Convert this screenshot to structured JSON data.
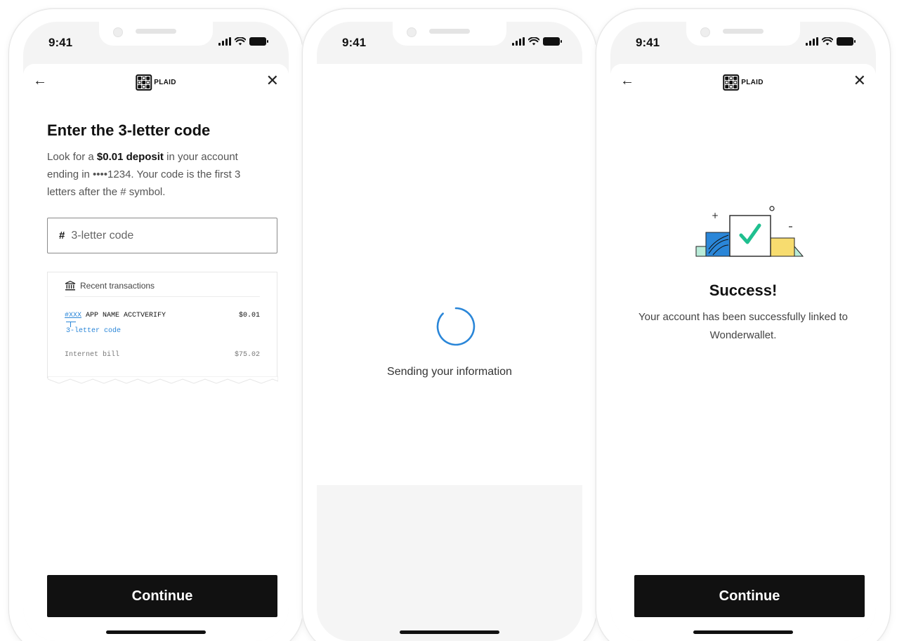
{
  "status_bar": {
    "time": "9:41"
  },
  "brand": {
    "name": "PLAID"
  },
  "screen1": {
    "title": "Enter the 3-letter code",
    "description_pre": "Look for a ",
    "description_bold": "$0.01 deposit",
    "description_post": " in your account ending in ••••1234. Your code is the first 3 letters after the # symbol.",
    "input": {
      "prefix": "#",
      "placeholder": "3-letter code",
      "value": ""
    },
    "receipt": {
      "header": "Recent transactions",
      "rows": [
        {
          "code": "#XXX",
          "desc": " APP NAME ACCTVERIFY",
          "amount": "$0.01"
        },
        {
          "code": "",
          "desc": "Internet bill",
          "amount": "$75.02"
        }
      ],
      "caption": "3-letter code"
    },
    "button": "Continue"
  },
  "screen2": {
    "loading_text": "Sending your information"
  },
  "screen3": {
    "title": "Success!",
    "description": "Your account has been successfully linked to Wonderwallet.",
    "button": "Continue"
  },
  "colors": {
    "accent_blue": "#2a86d8",
    "success_green": "#1fbf8f",
    "illustration_yellow": "#f7dc6f",
    "button_black": "#111111"
  },
  "icons": [
    "arrow-left-icon",
    "close-icon",
    "plaid-logo-icon",
    "bank-icon",
    "cellular-signal-icon",
    "wifi-icon",
    "battery-icon",
    "checkmark-icon",
    "loading-spinner-icon"
  ]
}
